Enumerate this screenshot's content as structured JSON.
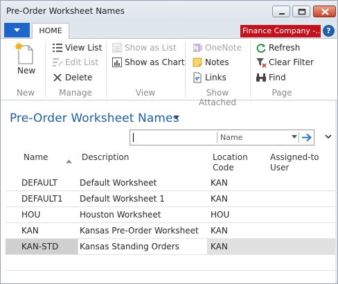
{
  "window": {
    "title": "Pre-Order Worksheet Names"
  },
  "ribbon": {
    "tab_home": "HOME",
    "company": "Finance Company -...",
    "help_label": "?",
    "groups": {
      "new": {
        "label": "New",
        "new_button": "New"
      },
      "manage": {
        "label": "Manage",
        "view_list": "View List",
        "edit_list": "Edit List",
        "delete": "Delete"
      },
      "view": {
        "label": "View",
        "show_as_list": "Show as List",
        "show_as_chart": "Show as Chart"
      },
      "show_attached": {
        "label": "Show Attached",
        "onenote": "OneNote",
        "notes": "Notes",
        "links": "Links"
      },
      "page": {
        "label": "Page",
        "refresh": "Refresh",
        "clear_filter": "Clear Filter",
        "find": "Find"
      }
    }
  },
  "page": {
    "title": "Pre-Order Worksheet Names"
  },
  "filter": {
    "value": "",
    "field": "Name"
  },
  "table": {
    "headers": {
      "name": "Name",
      "description": "Description",
      "location_code": [
        "Location",
        "Code"
      ],
      "assigned_to_user": [
        "Assigned-to",
        "User"
      ]
    },
    "rows": [
      {
        "name": "DEFAULT",
        "description": "Default Worksheet",
        "location_code": "KAN",
        "assigned_to_user": ""
      },
      {
        "name": "DEFAULT1",
        "description": "Default Worksheet 1",
        "location_code": "KAN",
        "assigned_to_user": ""
      },
      {
        "name": "HOU",
        "description": "Houston Worksheet",
        "location_code": "HOU",
        "assigned_to_user": ""
      },
      {
        "name": "KAN",
        "description": "Kansas Pre-Order Worksheet",
        "location_code": "KAN",
        "assigned_to_user": ""
      },
      {
        "name": "KAN-STD",
        "description": "Kansas Standing Orders",
        "location_code": "KAN",
        "assigned_to_user": ""
      }
    ],
    "selected_row": 4
  },
  "colors": {
    "accent": "#1f5f9e",
    "app_menu": "#1e65c9",
    "company_badge": "#c2121c"
  }
}
